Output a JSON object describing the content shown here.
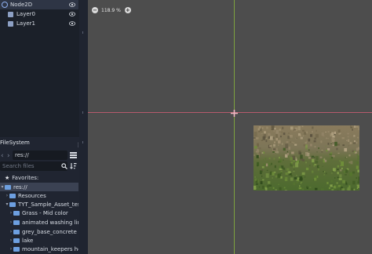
{
  "scene_tree": {
    "nodes": [
      {
        "label": "Node2D",
        "icon": "node2d-icon"
      },
      {
        "label": "Layer0",
        "icon": "tilemap-layer-icon"
      },
      {
        "label": "Layer1",
        "icon": "tilemap-layer-icon"
      }
    ]
  },
  "filesystem": {
    "title": "FileSystem",
    "path": "res://",
    "search_placeholder": "Search files",
    "favorites_label": "Favorites:",
    "root_label": "res://",
    "items": [
      {
        "label": "Resources"
      },
      {
        "label": "TYT_Sample_Asset_test"
      },
      {
        "label": "Grass - Mid color"
      },
      {
        "label": "animated washing line"
      },
      {
        "label": "grey_base_concrete"
      },
      {
        "label": "lake"
      },
      {
        "label": "mountain_keepers hous"
      }
    ]
  },
  "viewport": {
    "zoom_level": "118.9 %",
    "zoom_out_symbol": "−",
    "zoom_in_symbol": "+"
  },
  "colors": {
    "accent_folder": "#6d9fe0",
    "guide_horizontal": "#b65a6c",
    "guide_vertical": "#7ea23e",
    "viewport_bg": "#4d4d4d"
  }
}
